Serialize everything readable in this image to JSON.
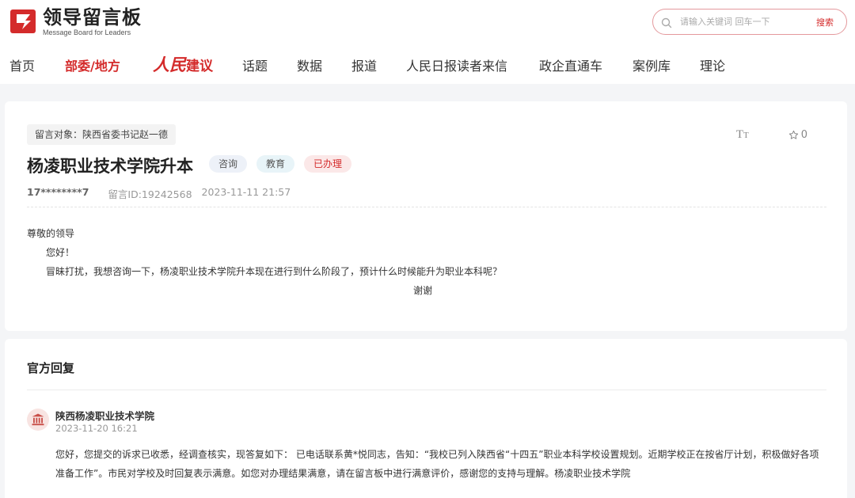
{
  "header": {
    "logo_title": "领导留言板",
    "logo_subtitle": "Message Board for Leaders",
    "brand_color": "#d42b2b",
    "search": {
      "placeholder": "请输入关键词 回车一下",
      "button_label": "搜索"
    }
  },
  "nav": {
    "items": [
      {
        "label": "首页"
      },
      {
        "label": "部委/地方",
        "active": true
      },
      {
        "label_script": "人民",
        "label_suffix": "建议"
      },
      {
        "label": "话题"
      },
      {
        "label": "数据"
      },
      {
        "label": "报道"
      },
      {
        "label": "人民日报读者来信"
      },
      {
        "label": "政企直通车"
      },
      {
        "label": "案例库"
      },
      {
        "label": "理论"
      }
    ]
  },
  "message": {
    "target": "留言对象：陕西省委书记赵一德",
    "title": "杨凌职业技术学院升本",
    "tags": {
      "type": "咨询",
      "domain": "教育",
      "status": "已办理"
    },
    "font_size_icon": "text-size-icon",
    "favorite_count": "0",
    "user": "17********7",
    "id": "留言ID:19242568",
    "time": "2023-11-11 21:57",
    "body": {
      "salutation": "尊敬的领导",
      "greeting": "您好！",
      "content": "冒昧打扰，我想咨询一下，杨凌职业技术学院升本现在进行到什么阶段了，预计什么时候能升为职业本科呢？",
      "closing": "谢谢"
    }
  },
  "reply": {
    "heading": "官方回复",
    "organization": "陕西杨凌职业技术学院",
    "date": "2023-11-20 16:21",
    "avatar_icon": "government-building-icon",
    "content": "您好，您提交的诉求已收悉，经调查核实，现答复如下： 已电话联系黄*悦同志，告知：“我校已列入陕西省“十四五”职业本科学校设置规划。近期学校正在按省厅计划，积极做好各项准备工作”。市民对学校及时回复表示满意。如您对办理结果满意，请在留言板中进行满意评价，感谢您的支持与理解。杨凌职业技术学院"
  }
}
